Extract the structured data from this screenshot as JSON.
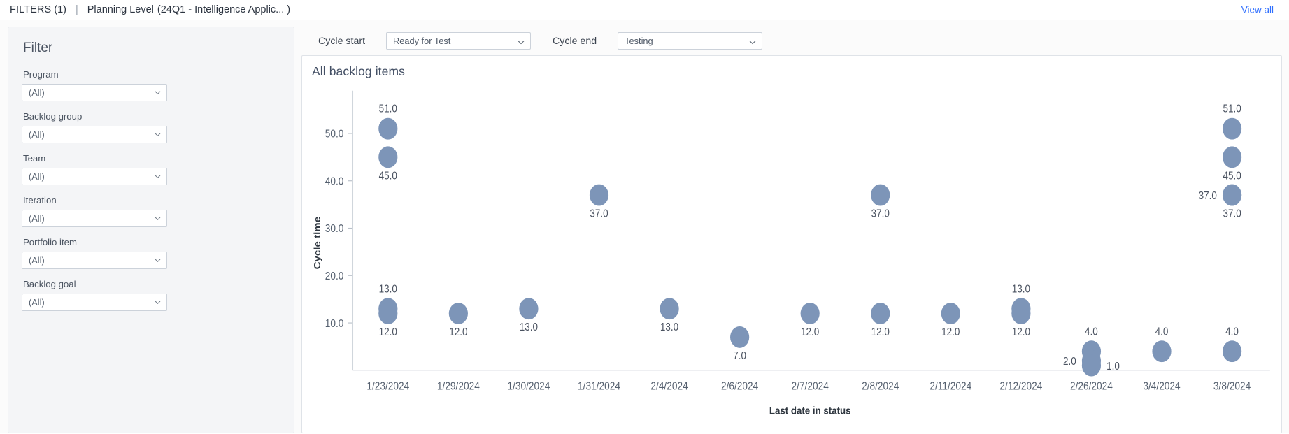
{
  "topbar": {
    "filters_label": "FILTERS",
    "filters_count": "(1)",
    "separator": "|",
    "planning_level_label": "Planning Level",
    "planning_level_value": "(24Q1 - Intelligence Applic... )",
    "view_all_label": "View all",
    "link_color": "#2f6fff"
  },
  "filter_panel": {
    "title": "Filter",
    "fields": [
      {
        "label": "Program",
        "value": "(All)"
      },
      {
        "label": "Backlog group",
        "value": "(All)"
      },
      {
        "label": "Team",
        "value": "(All)"
      },
      {
        "label": "Iteration",
        "value": "(All)"
      },
      {
        "label": "Portfolio item",
        "value": "(All)"
      },
      {
        "label": "Backlog goal",
        "value": "(All)"
      }
    ]
  },
  "cycle_controls": {
    "start_label": "Cycle start",
    "start_value": "Ready for Test",
    "end_label": "Cycle end",
    "end_value": "Testing"
  },
  "chart_card": {
    "title": "All backlog items"
  },
  "chart_data": {
    "type": "scatter",
    "title": "All backlog items",
    "xlabel": "Last date in status",
    "ylabel": "Cycle time",
    "grid": false,
    "legend": "none",
    "marker_color": "#7d95b8",
    "ylim": [
      0,
      56
    ],
    "yticks": [
      "10.0",
      "20.0",
      "30.0",
      "40.0",
      "50.0"
    ],
    "ytick_values": [
      10,
      20,
      30,
      40,
      50
    ],
    "categories": [
      "1/23/2024",
      "1/29/2024",
      "1/30/2024",
      "1/31/2024",
      "2/4/2024",
      "2/6/2024",
      "2/7/2024",
      "2/8/2024",
      "2/11/2024",
      "2/12/2024",
      "2/26/2024",
      "3/4/2024",
      "3/8/2024"
    ],
    "points": [
      {
        "x": "1/23/2024",
        "y": 51,
        "label": "51.0",
        "label_pos": "top"
      },
      {
        "x": "1/23/2024",
        "y": 45,
        "label": "45.0",
        "label_pos": "bottom"
      },
      {
        "x": "1/23/2024",
        "y": 13,
        "label": "13.0",
        "label_pos": "top"
      },
      {
        "x": "1/23/2024",
        "y": 12,
        "label": "12.0",
        "label_pos": "bottom"
      },
      {
        "x": "1/29/2024",
        "y": 12,
        "label": "12.0",
        "label_pos": "bottom"
      },
      {
        "x": "1/30/2024",
        "y": 13,
        "label": "13.0",
        "label_pos": "bottom"
      },
      {
        "x": "1/31/2024",
        "y": 37,
        "label": "37.0",
        "label_pos": "bottom"
      },
      {
        "x": "2/4/2024",
        "y": 13,
        "label": "13.0",
        "label_pos": "bottom"
      },
      {
        "x": "2/6/2024",
        "y": 7,
        "label": "7.0",
        "label_pos": "bottom"
      },
      {
        "x": "2/7/2024",
        "y": 12,
        "label": "12.0",
        "label_pos": "bottom"
      },
      {
        "x": "2/8/2024",
        "y": 37,
        "label": "37.0",
        "label_pos": "bottom"
      },
      {
        "x": "2/8/2024",
        "y": 12,
        "label": "12.0",
        "label_pos": "bottom"
      },
      {
        "x": "2/11/2024",
        "y": 12,
        "label": "12.0",
        "label_pos": "bottom"
      },
      {
        "x": "2/12/2024",
        "y": 13,
        "label": "13.0",
        "label_pos": "top"
      },
      {
        "x": "2/12/2024",
        "y": 12,
        "label": "12.0",
        "label_pos": "bottom"
      },
      {
        "x": "2/26/2024",
        "y": 4,
        "label": "4.0",
        "label_pos": "top"
      },
      {
        "x": "2/26/2024",
        "y": 2,
        "label": "2.0",
        "label_pos": "left"
      },
      {
        "x": "2/26/2024",
        "y": 1,
        "label": "1.0",
        "label_pos": "right"
      },
      {
        "x": "3/4/2024",
        "y": 4,
        "label": "4.0",
        "label_pos": "top"
      },
      {
        "x": "3/8/2024",
        "y": 51,
        "label": "51.0",
        "label_pos": "top"
      },
      {
        "x": "3/8/2024",
        "y": 45,
        "label": "45.0",
        "label_pos": "bottom"
      },
      {
        "x": "3/8/2024",
        "y": 37,
        "label": "37.0",
        "label_pos": "left"
      },
      {
        "x": "3/8/2024",
        "y": 37,
        "label": "37.0",
        "label_pos": "bottom"
      },
      {
        "x": "3/8/2024",
        "y": 4,
        "label": "4.0",
        "label_pos": "top"
      }
    ]
  }
}
